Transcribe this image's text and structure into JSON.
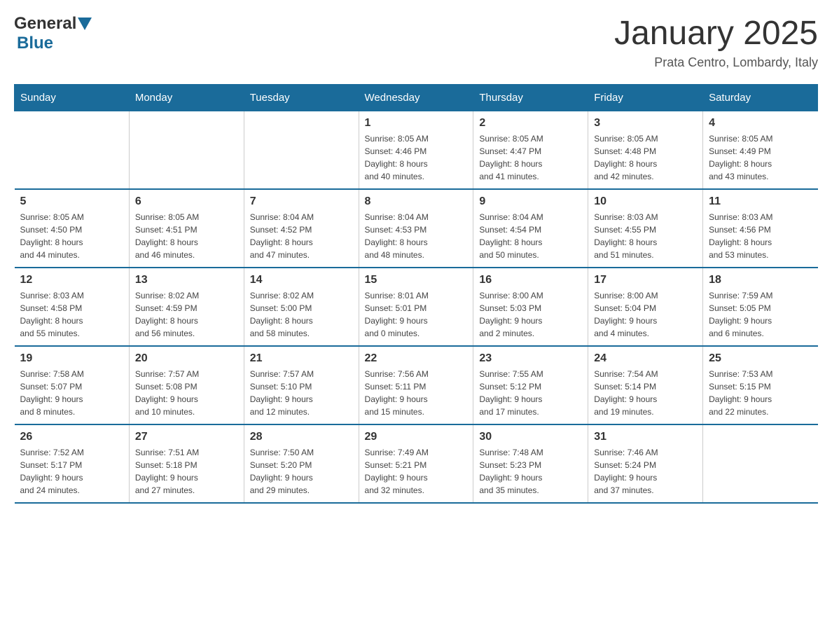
{
  "logo": {
    "general": "General",
    "blue": "Blue"
  },
  "title": "January 2025",
  "subtitle": "Prata Centro, Lombardy, Italy",
  "columns": [
    "Sunday",
    "Monday",
    "Tuesday",
    "Wednesday",
    "Thursday",
    "Friday",
    "Saturday"
  ],
  "weeks": [
    [
      {
        "day": "",
        "info": ""
      },
      {
        "day": "",
        "info": ""
      },
      {
        "day": "",
        "info": ""
      },
      {
        "day": "1",
        "info": "Sunrise: 8:05 AM\nSunset: 4:46 PM\nDaylight: 8 hours\nand 40 minutes."
      },
      {
        "day": "2",
        "info": "Sunrise: 8:05 AM\nSunset: 4:47 PM\nDaylight: 8 hours\nand 41 minutes."
      },
      {
        "day": "3",
        "info": "Sunrise: 8:05 AM\nSunset: 4:48 PM\nDaylight: 8 hours\nand 42 minutes."
      },
      {
        "day": "4",
        "info": "Sunrise: 8:05 AM\nSunset: 4:49 PM\nDaylight: 8 hours\nand 43 minutes."
      }
    ],
    [
      {
        "day": "5",
        "info": "Sunrise: 8:05 AM\nSunset: 4:50 PM\nDaylight: 8 hours\nand 44 minutes."
      },
      {
        "day": "6",
        "info": "Sunrise: 8:05 AM\nSunset: 4:51 PM\nDaylight: 8 hours\nand 46 minutes."
      },
      {
        "day": "7",
        "info": "Sunrise: 8:04 AM\nSunset: 4:52 PM\nDaylight: 8 hours\nand 47 minutes."
      },
      {
        "day": "8",
        "info": "Sunrise: 8:04 AM\nSunset: 4:53 PM\nDaylight: 8 hours\nand 48 minutes."
      },
      {
        "day": "9",
        "info": "Sunrise: 8:04 AM\nSunset: 4:54 PM\nDaylight: 8 hours\nand 50 minutes."
      },
      {
        "day": "10",
        "info": "Sunrise: 8:03 AM\nSunset: 4:55 PM\nDaylight: 8 hours\nand 51 minutes."
      },
      {
        "day": "11",
        "info": "Sunrise: 8:03 AM\nSunset: 4:56 PM\nDaylight: 8 hours\nand 53 minutes."
      }
    ],
    [
      {
        "day": "12",
        "info": "Sunrise: 8:03 AM\nSunset: 4:58 PM\nDaylight: 8 hours\nand 55 minutes."
      },
      {
        "day": "13",
        "info": "Sunrise: 8:02 AM\nSunset: 4:59 PM\nDaylight: 8 hours\nand 56 minutes."
      },
      {
        "day": "14",
        "info": "Sunrise: 8:02 AM\nSunset: 5:00 PM\nDaylight: 8 hours\nand 58 minutes."
      },
      {
        "day": "15",
        "info": "Sunrise: 8:01 AM\nSunset: 5:01 PM\nDaylight: 9 hours\nand 0 minutes."
      },
      {
        "day": "16",
        "info": "Sunrise: 8:00 AM\nSunset: 5:03 PM\nDaylight: 9 hours\nand 2 minutes."
      },
      {
        "day": "17",
        "info": "Sunrise: 8:00 AM\nSunset: 5:04 PM\nDaylight: 9 hours\nand 4 minutes."
      },
      {
        "day": "18",
        "info": "Sunrise: 7:59 AM\nSunset: 5:05 PM\nDaylight: 9 hours\nand 6 minutes."
      }
    ],
    [
      {
        "day": "19",
        "info": "Sunrise: 7:58 AM\nSunset: 5:07 PM\nDaylight: 9 hours\nand 8 minutes."
      },
      {
        "day": "20",
        "info": "Sunrise: 7:57 AM\nSunset: 5:08 PM\nDaylight: 9 hours\nand 10 minutes."
      },
      {
        "day": "21",
        "info": "Sunrise: 7:57 AM\nSunset: 5:10 PM\nDaylight: 9 hours\nand 12 minutes."
      },
      {
        "day": "22",
        "info": "Sunrise: 7:56 AM\nSunset: 5:11 PM\nDaylight: 9 hours\nand 15 minutes."
      },
      {
        "day": "23",
        "info": "Sunrise: 7:55 AM\nSunset: 5:12 PM\nDaylight: 9 hours\nand 17 minutes."
      },
      {
        "day": "24",
        "info": "Sunrise: 7:54 AM\nSunset: 5:14 PM\nDaylight: 9 hours\nand 19 minutes."
      },
      {
        "day": "25",
        "info": "Sunrise: 7:53 AM\nSunset: 5:15 PM\nDaylight: 9 hours\nand 22 minutes."
      }
    ],
    [
      {
        "day": "26",
        "info": "Sunrise: 7:52 AM\nSunset: 5:17 PM\nDaylight: 9 hours\nand 24 minutes."
      },
      {
        "day": "27",
        "info": "Sunrise: 7:51 AM\nSunset: 5:18 PM\nDaylight: 9 hours\nand 27 minutes."
      },
      {
        "day": "28",
        "info": "Sunrise: 7:50 AM\nSunset: 5:20 PM\nDaylight: 9 hours\nand 29 minutes."
      },
      {
        "day": "29",
        "info": "Sunrise: 7:49 AM\nSunset: 5:21 PM\nDaylight: 9 hours\nand 32 minutes."
      },
      {
        "day": "30",
        "info": "Sunrise: 7:48 AM\nSunset: 5:23 PM\nDaylight: 9 hours\nand 35 minutes."
      },
      {
        "day": "31",
        "info": "Sunrise: 7:46 AM\nSunset: 5:24 PM\nDaylight: 9 hours\nand 37 minutes."
      },
      {
        "day": "",
        "info": ""
      }
    ]
  ]
}
